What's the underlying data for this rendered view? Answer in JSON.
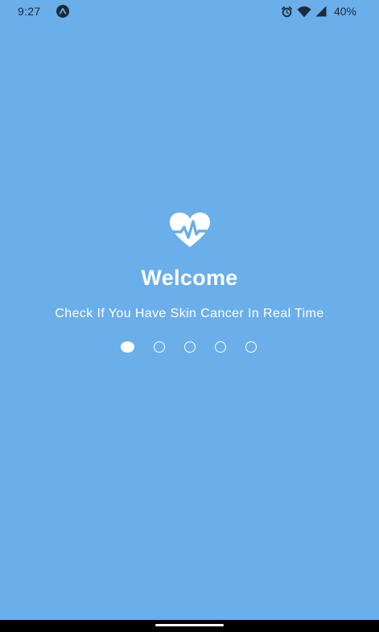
{
  "status_bar": {
    "time": "9:27",
    "notification_icon": "android-a-icon",
    "icons": [
      "alarm-icon",
      "wifi-icon",
      "signal-icon"
    ],
    "battery": "40%"
  },
  "splash": {
    "icon": "heart-pulse-icon",
    "title": "Welcome",
    "subtitle": "Check If You Have Skin Cancer In Real Time"
  },
  "pager": {
    "total_pages": 5,
    "current_page": 1
  },
  "colors": {
    "background": "#6aaeea",
    "foreground": "#ffffff",
    "status_text": "#1c2a3a",
    "nav_bar": "#000000"
  }
}
